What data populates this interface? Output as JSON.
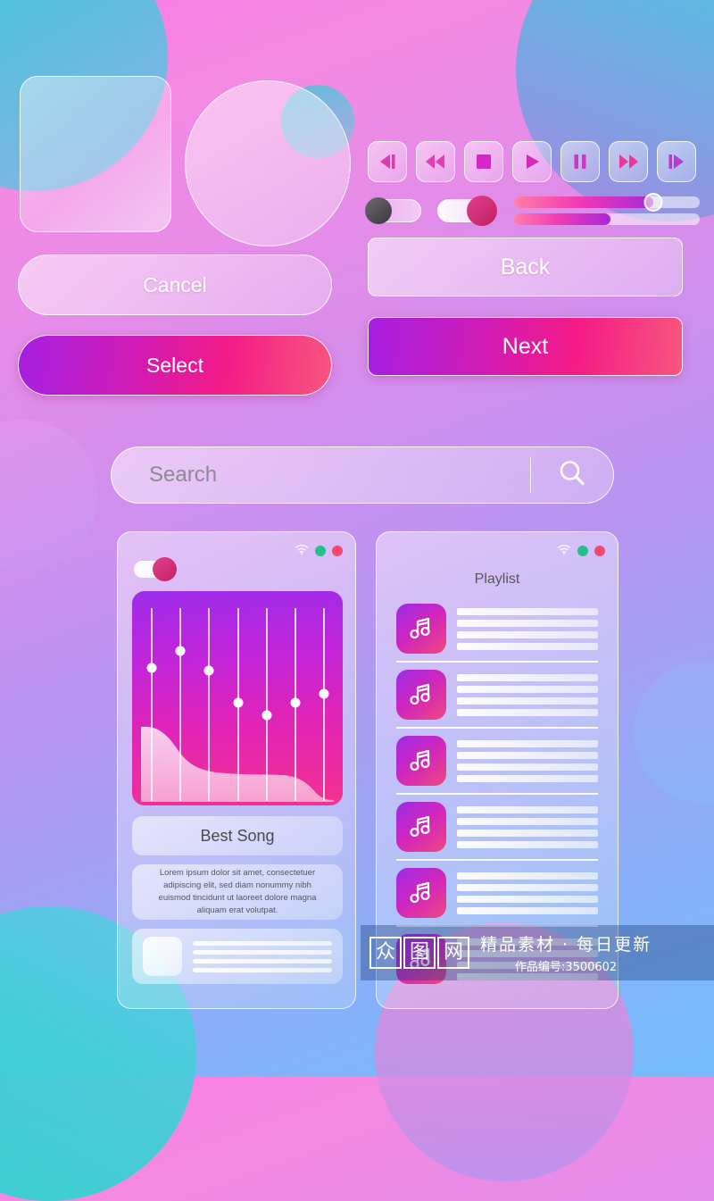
{
  "theme": {
    "bg_from": "#fb7ae6",
    "bg_to": "#74bdfb",
    "accent_purple": "#a51fe0",
    "accent_pink": "#f41b86",
    "teal": "#21d6cf",
    "dot_green": "#23c08c",
    "dot_red": "#f2496f"
  },
  "hero": {
    "square_label": "glass-square",
    "circle_label": "glass-circle",
    "accent_circle_label": "teal-accent-circle"
  },
  "media_controls": {
    "buttons": [
      {
        "name": "skip-back",
        "icon": "skip-back-icon"
      },
      {
        "name": "rewind",
        "icon": "rewind-icon"
      },
      {
        "name": "stop",
        "icon": "stop-icon"
      },
      {
        "name": "play",
        "icon": "play-icon"
      },
      {
        "name": "pause",
        "icon": "pause-icon"
      },
      {
        "name": "fast-forward",
        "icon": "fast-forward-icon"
      },
      {
        "name": "skip-forward",
        "icon": "skip-forward-icon"
      }
    ]
  },
  "toggles": [
    {
      "name": "toggle-off",
      "state": "off"
    },
    {
      "name": "toggle-on",
      "state": "on"
    }
  ],
  "sliders": [
    {
      "name": "progress-slider-top",
      "value": 75
    },
    {
      "name": "progress-slider-bottom",
      "value": 52
    }
  ],
  "buttons": {
    "cancel": "Cancel",
    "select": "Select",
    "back": "Back",
    "next": "Next"
  },
  "search": {
    "placeholder": "Search",
    "value": "",
    "icon": "search-icon"
  },
  "player_card": {
    "window_icons": [
      "wifi-icon",
      "green-dot",
      "red-dot"
    ],
    "toggle_state": "on",
    "equalizer": {
      "bands": 7,
      "dot_positions_percent": [
        36,
        28,
        37,
        52,
        58,
        52,
        48
      ]
    },
    "title": "Best Song",
    "description": "Lorem ipsum dolor sit amet, consectetuer adipiscing elit, sed diam nonummy nibh euismod tincidunt ut laoreet dolore magna aliquam erat volutpat.",
    "item_placeholder_lines": 4
  },
  "playlist_card": {
    "window_icons": [
      "wifi-icon",
      "green-dot",
      "red-dot"
    ],
    "title": "Playlist",
    "row_count": 6,
    "row_icon": "music-note-icon",
    "row_placeholder_lines": 4
  },
  "watermark": {
    "logo_chars": [
      "众",
      "图",
      "网"
    ],
    "tagline": "精品素材 · 每日更新",
    "code": "作品编号:3500602"
  }
}
